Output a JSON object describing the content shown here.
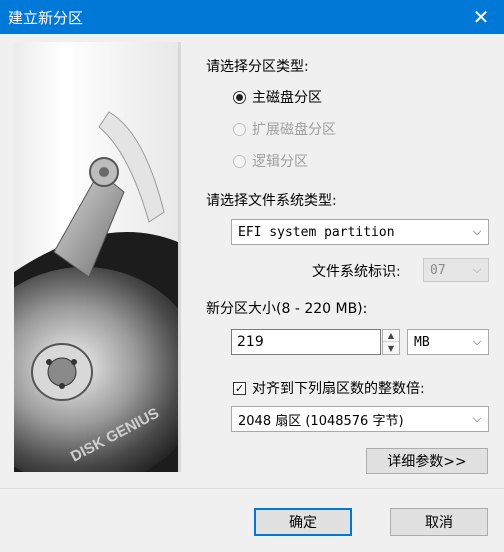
{
  "window": {
    "title": "建立新分区",
    "close_glyph": "✕"
  },
  "art": {
    "brand_text": "DISK GENIUS"
  },
  "partition_type": {
    "label": "请选择分区类型:",
    "options": [
      {
        "label": "主磁盘分区",
        "selected": true,
        "enabled": true
      },
      {
        "label": "扩展磁盘分区",
        "selected": false,
        "enabled": false
      },
      {
        "label": "逻辑分区",
        "selected": false,
        "enabled": false
      }
    ]
  },
  "fs_type": {
    "label": "请选择文件系统类型:",
    "value": "EFI system partition",
    "id_label": "文件系统标识:",
    "id_value": "07"
  },
  "size": {
    "label": "新分区大小(8 - 220 MB):",
    "value": "219",
    "unit": "MB"
  },
  "align": {
    "checked": true,
    "label": "对齐到下列扇区数的整数倍:",
    "value": "2048 扇区 (1048576 字节)"
  },
  "buttons": {
    "details": "详细参数>>",
    "ok": "确定",
    "cancel": "取消"
  },
  "icons": {
    "caret": "chevron-down-icon",
    "check": "checkmark-icon",
    "close": "close-icon"
  }
}
